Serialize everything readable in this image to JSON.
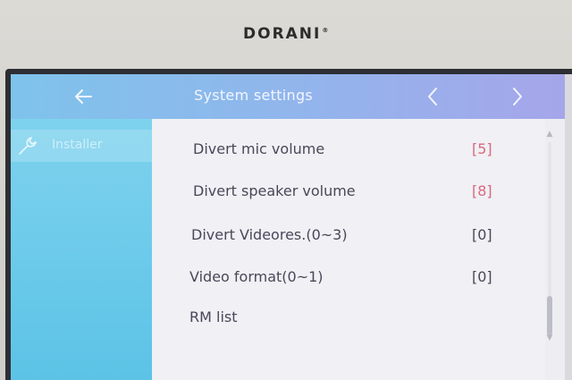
{
  "device": {
    "brand": "DORANI",
    "brand_mark": "®"
  },
  "header": {
    "title": "System settings",
    "icons": {
      "back": "arrow-left-icon",
      "prev": "chevron-left-icon",
      "next": "chevron-right-icon"
    }
  },
  "sidebar": {
    "items": [
      {
        "label": "Installer",
        "icon": "wrench-icon",
        "selected": true
      }
    ]
  },
  "settings": [
    {
      "label": "Divert mic volume",
      "value": "[5]",
      "value_color": "#d96a7c"
    },
    {
      "label": "Divert speaker volume",
      "value": "[8]",
      "value_color": "#d96a7c"
    },
    {
      "label": "Divert Videores.(0~3)",
      "value": "[0]",
      "value_color": "#4a4758"
    },
    {
      "label": "Video format(0~1)",
      "value": "[0]",
      "value_color": "#4a4758"
    },
    {
      "label": "RM list",
      "value": "",
      "value_color": "#4a4758"
    }
  ],
  "colors": {
    "header_start": "#7ec3eb",
    "header_end": "#a5a6ea",
    "sidebar": "#5cc3e6",
    "content_bg": "#f0f0f5",
    "accent_value": "#d96a7c"
  }
}
